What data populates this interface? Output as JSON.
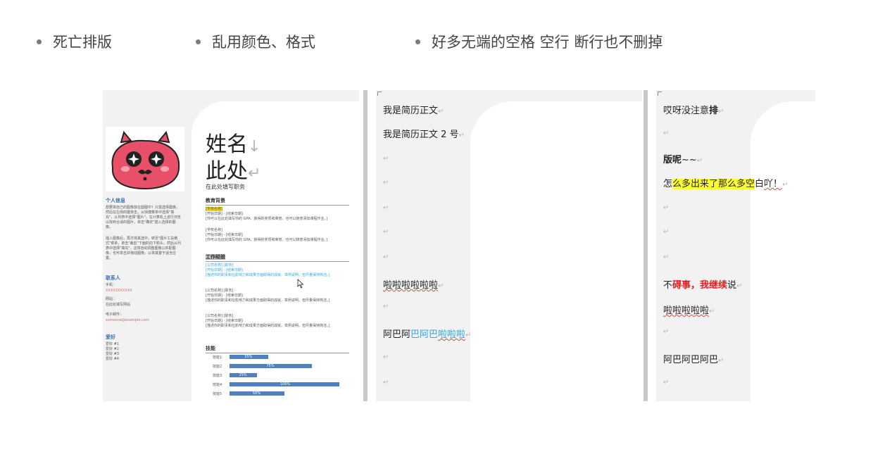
{
  "bullets": [
    {
      "text": "死亡排版"
    },
    {
      "text": "乱用颜色、格式"
    },
    {
      "text": "好多无端的空格 空行 断行也不删掉"
    }
  ],
  "resume": {
    "name_line1": "姓名",
    "name_line2": "此处",
    "subtitle": "在此处填写职务",
    "side_personal_head": "个人信息",
    "side_personal_text1": "想要将自己的图像放在圆圈中？只需选择图像，然后在左侧的键单击，从快捷菜单中选择\"填充\"，从列表中选择\"图片\"。在计算机上进行浏览以找到合适的图片，单击\"确定\"插入选择的图像。",
    "side_personal_text2": "插入图像后，再次将其选中，转至\"图片工具格式\"菜单，单击\"裁剪\"下面的向下箭头，然后从列表中选择\"填充\"。这将自动调整图像以匹配图像，也可单击并拖动图像，以将其置于适当位置。",
    "side_contact_head": "联系人",
    "side_phone_label": "手机：",
    "side_phone_value": "XXXXXXXXXXX",
    "side_web_label": "网站：",
    "side_web_value": "在此处填写网站",
    "side_email_label": "电子邮件：",
    "side_email_value": "someone@example.com",
    "side_hobby_head": "爱好",
    "hobbies": [
      "爱好 #1",
      "爱好 #2",
      "爱好 #3",
      "爱好 #4"
    ],
    "edu_head": "教育背景",
    "edu_school1": "[学校名称]",
    "edu_date1": "[开始日期] - [结束日期]",
    "edu_desc1": "[你可以在此处填写你的 GPA、获得的奖项和荣誉。也可以随意添加课程作业。]",
    "edu_school2": "[学校名称]",
    "edu_date2": "[开始日期] - [结束日期]",
    "edu_desc2": "[你可以在此处填写你的 GPA、获得的奖项和荣誉。也可以随意添加课程作业。]",
    "work_head": "工作经验",
    "work_company1": "[公司名称] [职务]",
    "work_date1": "[开始日期] - [结束日期]",
    "work_desc1": "[描述你的职责和在影响力和成果方面取得的成就。举例说明，但尽量保持简洁。]",
    "work_company2": "[公司名称] [职务]",
    "work_date2": "[开始日期] - [结束日期]",
    "work_desc2": "[描述你的职责和在影响力和成果方面取得的成就。举例说明，但尽量保持简洁。]",
    "work_company3": "[公司名称] [职务]",
    "work_date3": "[开始日期] - [结束日期]",
    "work_desc3": "[描述你的职责和在影响力和成果方面取得的成就。举例说明，但尽量保持简洁。]",
    "skills_head": "技能",
    "skills": [
      {
        "label": "技能1",
        "value": 35,
        "pct": "35%"
      },
      {
        "label": "技能2",
        "value": 75,
        "pct": "75%"
      },
      {
        "label": "技能3",
        "value": 25,
        "pct": "25%"
      },
      {
        "label": "技能4",
        "value": 100,
        "pct": "100%"
      },
      {
        "label": "技能5",
        "value": 50,
        "pct": "50%"
      }
    ]
  },
  "doc2": {
    "line1": "我是简历正文",
    "line2": "我是简历正文 2 号",
    "line3": "啦啦啦啦啦啦",
    "line4_a": "阿巴阿",
    "line4_b": "巴阿巴",
    "line4_c": "啦啦啦"
  },
  "doc3": {
    "line1_a": "哎呀没注意",
    "line1_b": "排",
    "line2_a": "版呢",
    "line2_b": "~~",
    "line3_a": "怎",
    "line3_b": "么多出来了那么多空",
    "line3_c": "白",
    "line3_d": "吖！",
    "line4_a": "不",
    "line4_b": "碍事，我继续",
    "line4_c": "说",
    "line5": "啦啦啦啦啦",
    "line6": "阿巴阿巴阿巴"
  },
  "symbols": {
    "return_mark": "↵",
    "name_arrow": "↓"
  }
}
